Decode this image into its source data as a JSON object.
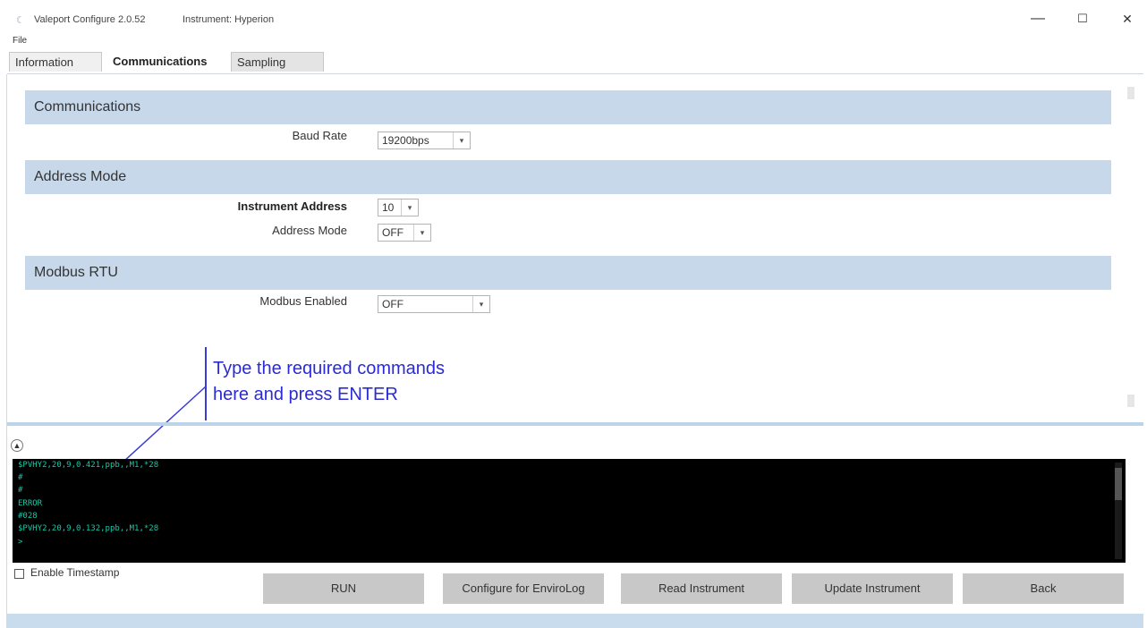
{
  "window": {
    "app_title": "Valeport Configure 2.0.52",
    "instrument_title": "Instrument: Hyperion",
    "minimize": "—",
    "maximize": "☐",
    "close": "✕"
  },
  "menu": {
    "file": "File"
  },
  "tabs": [
    {
      "label": "Information"
    },
    {
      "label": "Communications",
      "active": true
    },
    {
      "label": "Sampling"
    }
  ],
  "sections": {
    "communications": {
      "heading": "Communications",
      "baud_rate_label": "Baud Rate",
      "baud_rate_value": "19200bps"
    },
    "address_mode": {
      "heading": "Address Mode",
      "instrument_address_label": "Instrument Address",
      "instrument_address_value": "10",
      "address_mode_label": "Address Mode",
      "address_mode_value": "OFF"
    },
    "modbus": {
      "heading": "Modbus RTU",
      "modbus_enabled_label": "Modbus Enabled",
      "modbus_enabled_value": "OFF"
    }
  },
  "annotation": {
    "line1": "Type the required commands",
    "line2": "here and press ENTER"
  },
  "terminal": {
    "lines": [
      "$PVHY2,20,9,0.421,ppb,,M1,*28",
      "#",
      "#",
      "ERROR",
      "#028",
      "$PVHY2,20,9,0.132,ppb,,M1,*28",
      ">"
    ]
  },
  "timestamp": {
    "label": "Enable Timestamp",
    "checked": false
  },
  "buttons": {
    "run": "RUN",
    "configure": "Configure for EnviroLog",
    "read": "Read Instrument",
    "update": "Update Instrument",
    "back": "Back"
  },
  "colors": {
    "section_header": "#c7d8ea",
    "annotation": "#2a2ad6",
    "terminal_text": "#16c9a8",
    "terminal_bg": "#000000"
  }
}
